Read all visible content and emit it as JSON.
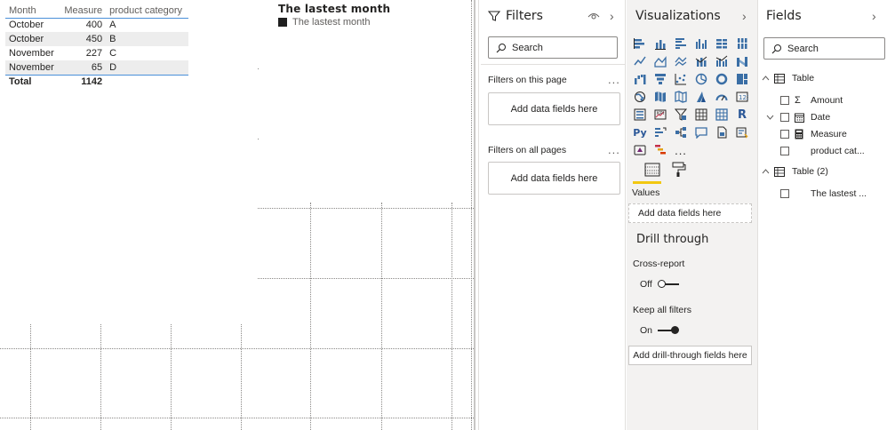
{
  "table_visual": {
    "headers": [
      "Month",
      "Measure",
      "product category"
    ],
    "rows": [
      {
        "month": "October",
        "measure": "400",
        "category": "A"
      },
      {
        "month": "October",
        "measure": "450",
        "category": "B"
      },
      {
        "month": "November",
        "measure": "227",
        "category": "C"
      },
      {
        "month": "November",
        "measure": "65",
        "category": "D"
      }
    ],
    "total": {
      "label": "Total",
      "value": "1142"
    }
  },
  "chart_visual": {
    "title": "The lastest month",
    "legend_label": "The lastest month",
    "legend_color": "#1f1f1f"
  },
  "filters": {
    "title": "Filters",
    "search_placeholder": "Search",
    "on_this_page": "Filters on this page",
    "on_all_pages": "Filters on all pages",
    "add_fields": "Add data fields here",
    "more": "..."
  },
  "visualizations": {
    "title": "Visualizations",
    "icons": [
      "stacked-bar-chart-icon",
      "stacked-column-chart-icon",
      "clustered-bar-chart-icon",
      "clustered-column-chart-icon",
      "100-stacked-bar-chart-icon",
      "100-stacked-column-chart-icon",
      "line-chart-icon",
      "area-chart-icon",
      "stacked-area-chart-icon",
      "line-and-stacked-column-icon",
      "line-and-clustered-column-icon",
      "ribbon-chart-icon",
      "waterfall-chart-icon",
      "funnel-chart-icon",
      "scatter-chart-icon",
      "pie-chart-icon",
      "donut-chart-icon",
      "treemap-icon",
      "map-icon",
      "filled-map-icon",
      "shape-map-icon",
      "azure-map-icon",
      "gauge-icon",
      "card-icon",
      "multi-row-card-icon",
      "kpi-icon",
      "slicer-icon",
      "table-icon",
      "matrix-icon",
      "r-visual-icon",
      "python-visual-icon",
      "key-influencers-icon",
      "decomposition-tree-icon",
      "qa-icon",
      "paginated-report-icon",
      "smart-narrative-icon",
      "power-apps-icon",
      "gantt-icon",
      "more-visuals-icon"
    ],
    "r_label": "R",
    "py_label": "Py",
    "more_label": "...",
    "values_label": "Values",
    "add_fields": "Add data fields here",
    "drill_through": "Drill through",
    "cross_report": "Cross-report",
    "cross_report_state": "Off",
    "keep_all_filters": "Keep all filters",
    "keep_all_filters_state": "On",
    "add_drill": "Add drill-through fields here",
    "accent_color": "#f2c811"
  },
  "fields": {
    "title": "Fields",
    "search_placeholder": "Search",
    "tables": [
      {
        "name": "Table",
        "fields": [
          "Amount",
          "Date",
          "Measure",
          "product cat..."
        ]
      },
      {
        "name": "Table (2)",
        "fields": [
          "The lastest ..."
        ]
      }
    ]
  }
}
